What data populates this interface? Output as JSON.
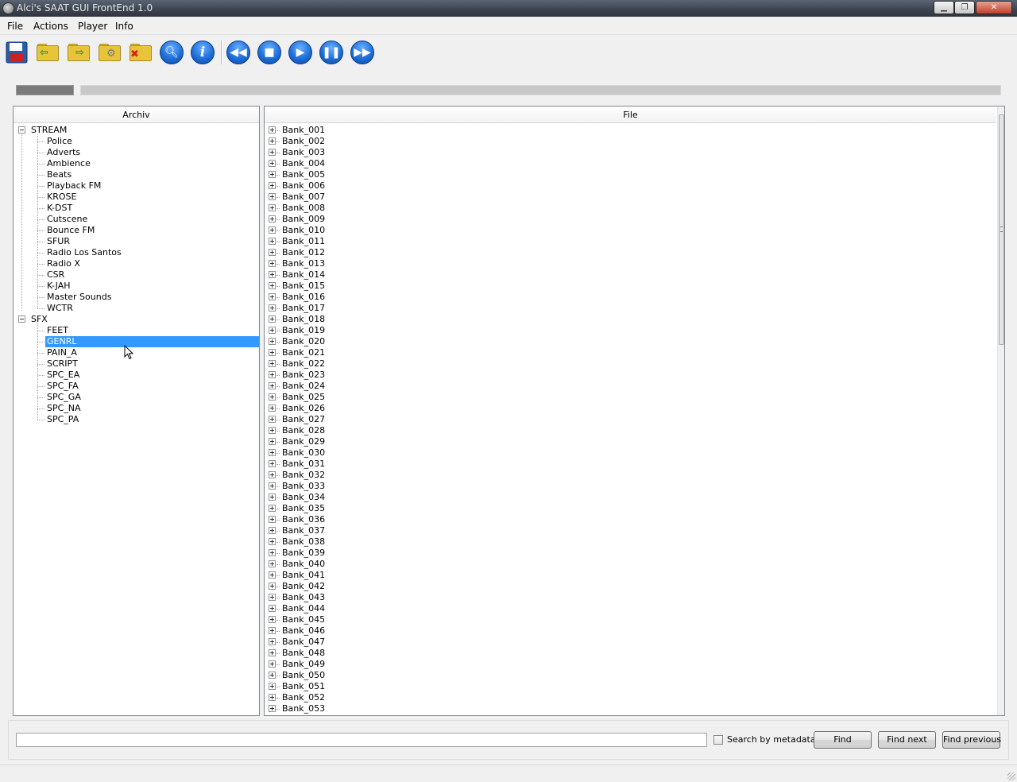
{
  "window": {
    "title": "Alci's SAAT GUI FrontEnd 1.0"
  },
  "menu": [
    "File",
    "Actions",
    "Player",
    "Info"
  ],
  "archive": {
    "header": "Archiv",
    "groups": [
      {
        "label": "STREAM",
        "children": [
          "Police",
          "Adverts",
          "Ambience",
          "Beats",
          "Playback FM",
          "KROSE",
          "K-DST",
          "Cutscene",
          "Bounce FM",
          "SFUR",
          "Radio Los Santos",
          "Radio X",
          "CSR",
          "K-JAH",
          "Master Sounds",
          "WCTR"
        ]
      },
      {
        "label": "SFX",
        "children": [
          "FEET",
          "GENRL",
          "PAIN_A",
          "SCRIPT",
          "SPC_EA",
          "SPC_FA",
          "SPC_GA",
          "SPC_NA",
          "SPC_PA"
        ]
      }
    ],
    "selected": "GENRL"
  },
  "file": {
    "header": "File",
    "items": [
      "Bank_001",
      "Bank_002",
      "Bank_003",
      "Bank_004",
      "Bank_005",
      "Bank_006",
      "Bank_007",
      "Bank_008",
      "Bank_009",
      "Bank_010",
      "Bank_011",
      "Bank_012",
      "Bank_013",
      "Bank_014",
      "Bank_015",
      "Bank_016",
      "Bank_017",
      "Bank_018",
      "Bank_019",
      "Bank_020",
      "Bank_021",
      "Bank_022",
      "Bank_023",
      "Bank_024",
      "Bank_025",
      "Bank_026",
      "Bank_027",
      "Bank_028",
      "Bank_029",
      "Bank_030",
      "Bank_031",
      "Bank_032",
      "Bank_033",
      "Bank_034",
      "Bank_035",
      "Bank_036",
      "Bank_037",
      "Bank_038",
      "Bank_039",
      "Bank_040",
      "Bank_041",
      "Bank_042",
      "Bank_043",
      "Bank_044",
      "Bank_045",
      "Bank_046",
      "Bank_047",
      "Bank_048",
      "Bank_049",
      "Bank_050",
      "Bank_051",
      "Bank_052",
      "Bank_053"
    ]
  },
  "search": {
    "input_value": "",
    "metadata_label": "Search by metadata",
    "metadata_checked": false,
    "find_label": "Find",
    "find_next_label": "Find next",
    "find_previous_label": "Find previous"
  },
  "toolbar": {
    "icons": [
      "save-icon",
      "open-archive-icon",
      "extract-icon",
      "settings-icon",
      "close-archive-icon",
      "search-icon",
      "info-icon",
      "rewind-icon",
      "stop-icon",
      "play-icon",
      "pause-icon",
      "fast-forward-icon"
    ]
  },
  "colors": {
    "selection": "#3399ff",
    "player_blue": "#1e6fd9",
    "folder_yellow": "#e8c43a"
  }
}
